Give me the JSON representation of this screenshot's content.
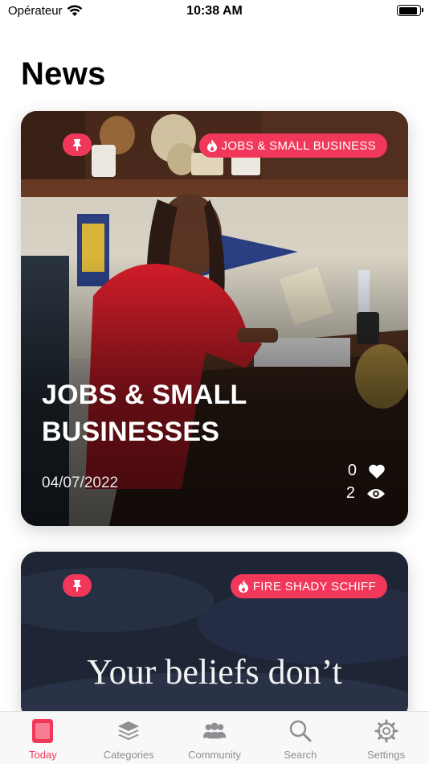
{
  "status_bar": {
    "carrier": "Opérateur",
    "time": "10:38 AM"
  },
  "page": {
    "title": "News"
  },
  "cards": [
    {
      "category": "JOBS & SMALL BUSINESS",
      "title": "JOBS & SMALL BUSINESSES",
      "date": "04/07/2022",
      "likes": "0",
      "views": "2"
    },
    {
      "category": "FIRE SHADY SCHIFF",
      "image_text": "Your beliefs don’t"
    }
  ],
  "tab_bar": {
    "items": [
      {
        "label": "Today",
        "icon": "today-icon",
        "active": true
      },
      {
        "label": "Categories",
        "icon": "layers-icon"
      },
      {
        "label": "Community",
        "icon": "people-icon"
      },
      {
        "label": "Search",
        "icon": "search-icon"
      },
      {
        "label": "Settings",
        "icon": "gear-icon"
      }
    ]
  },
  "colors": {
    "accent": "#f2385a",
    "tab_inactive": "#8e8e93"
  }
}
